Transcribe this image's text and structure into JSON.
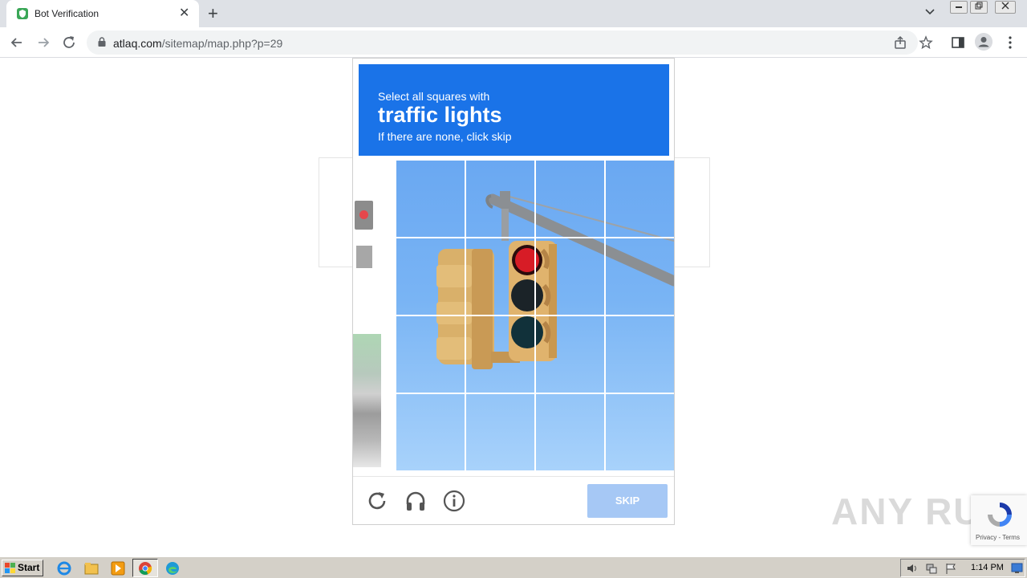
{
  "browser": {
    "tab_title": "Bot Verification",
    "url_host": "atlaq.com",
    "url_path": "/sitemap/map.php?p=29",
    "new_tab_label": "+",
    "close_tab_label": "✕"
  },
  "challenge": {
    "instruction_line1": "Select all squares with",
    "target": "traffic lights",
    "instruction_line3": "If there are none, click skip",
    "skip_label": "SKIP",
    "grid_rows": 4,
    "grid_cols": 4,
    "footer_icons": [
      "reload-icon",
      "headphones-icon",
      "info-icon"
    ]
  },
  "recaptcha_badge": {
    "links": "Privacy - Terms"
  },
  "watermark": "ANY RUN",
  "taskbar": {
    "start_label": "Start",
    "clock": "1:14 PM",
    "apps": [
      "ie-icon",
      "folder-icon",
      "media-player-icon",
      "chrome-icon",
      "edge-icon"
    ]
  },
  "colors": {
    "banner_blue": "#1a73e8",
    "skip_blue": "#a6c8f5"
  }
}
